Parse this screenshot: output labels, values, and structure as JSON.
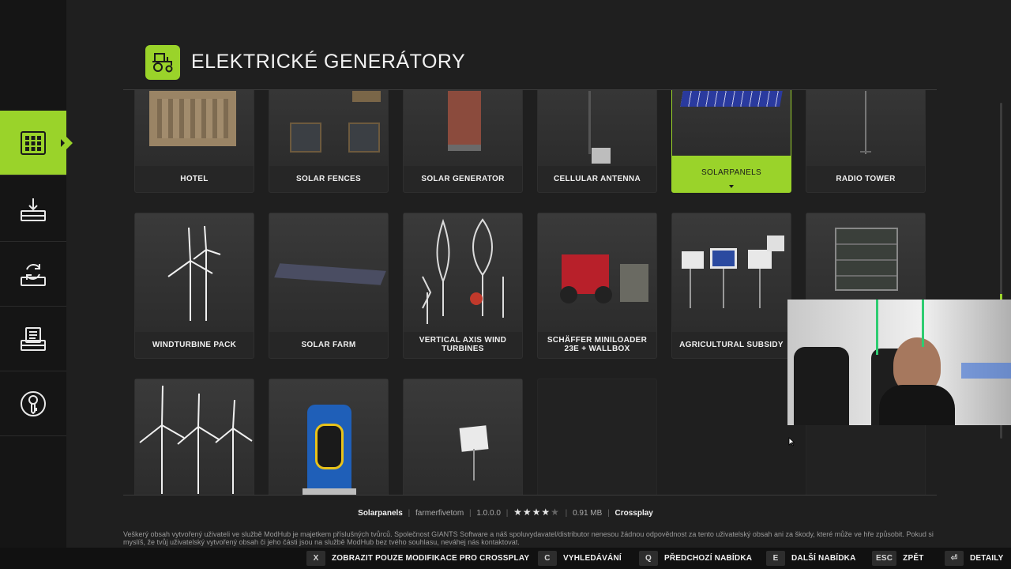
{
  "header": {
    "title": "ELEKTRICKÉ GENERÁTORY",
    "icon": "tractor-icon"
  },
  "sidebar": {
    "items": [
      {
        "name": "grid-icon",
        "active": true
      },
      {
        "name": "download-icon",
        "active": false
      },
      {
        "name": "update-icon",
        "active": false
      },
      {
        "name": "installed-icon",
        "active": false
      },
      {
        "name": "key-icon",
        "active": false
      }
    ]
  },
  "cards": [
    {
      "label": "HOTEL"
    },
    {
      "label": "SOLAR FENCES"
    },
    {
      "label": "SOLAR GENERATOR"
    },
    {
      "label": "CELLULAR ANTENNA"
    },
    {
      "label": "SOLARPANELS",
      "selected": true
    },
    {
      "label": "RADIO TOWER"
    },
    {
      "label": "WINDTURBINE PACK"
    },
    {
      "label": "SOLAR FARM"
    },
    {
      "label": "VERTICAL AXIS WIND TURBINES"
    },
    {
      "label": "SCHÄFFER MINILOADER 23E + WALLBOX"
    },
    {
      "label": "AGRICULTURAL SUBSIDY"
    },
    {
      "label": ""
    },
    {
      "label": ""
    },
    {
      "label": ""
    },
    {
      "label": ""
    }
  ],
  "info": {
    "name": "Solarpanels",
    "author": "farmerfivetom",
    "version": "1.0.0.0",
    "rating": 4,
    "rating_max": 5,
    "size": "0.91 MB",
    "crossplay": "Crossplay"
  },
  "disclaimer": "Veškerý obsah vytvořený uživateli ve službě ModHub je majetkem příslušných tvůrců. Společnost GIANTS Software a náš spoluvydavatel/distributor nenesou žádnou odpovědnost za tento uživatelský obsah ani za škody, které může ve hře způsobit. Pokud si myslíš, že tvůj uživatelský vytvořený obsah či jeho části jsou na službě ModHub bez tvého souhlasu, neváhej nás kontaktovat.",
  "actions": [
    {
      "key": "X",
      "label": "ZOBRAZIT POUZE MODIFIKACE PRO CROSSPLAY"
    },
    {
      "key": "C",
      "label": "VYHLEDÁVÁNÍ"
    },
    {
      "key": "Q",
      "label": "PŘEDCHOZÍ NABÍDKA"
    },
    {
      "key": "E",
      "label": "DALŠÍ NABÍDKA"
    },
    {
      "key": "ESC",
      "label": "ZPĚT"
    },
    {
      "key": "⏎",
      "label": "DETAILY"
    }
  ],
  "colors": {
    "accent": "#9ad32a",
    "background": "#1f1f1f",
    "sidebar": "#151515"
  }
}
